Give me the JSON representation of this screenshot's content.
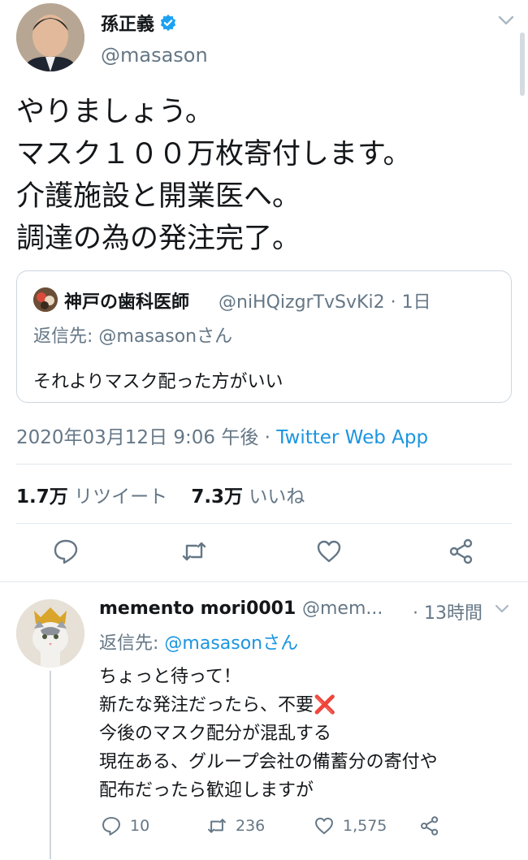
{
  "main_tweet": {
    "display_name": "孫正義",
    "handle": "@masason",
    "text_lines": [
      "やりましょう。",
      "マスク１００万枚寄付します。",
      "介護施設と開業医へ。",
      "調達の為の発注完了。"
    ],
    "quoted": {
      "display_name": "神戸の歯科医師",
      "handle": "@niHQizgrTvSvKi2",
      "age": "1日",
      "reply_prefix": "返信先: ",
      "reply_to": "@masasonさん",
      "text": "それよりマスク配った方がいい"
    },
    "timestamp": "2020年03月12日 9:06 午後",
    "separator": " · ",
    "source": "Twitter Web App",
    "retweets_count": "1.7万",
    "retweets_label": "リツイート",
    "likes_count": "7.3万",
    "likes_label": "いいね"
  },
  "reply_tweet": {
    "display_name": "memento mori0001",
    "handle": "@mem...",
    "age": "· 13時間",
    "reply_prefix": "返信先: ",
    "reply_to": "@masasonさん",
    "line1": "ちょっと待って！",
    "line2": "新たな発注だったら、不要",
    "line2_emoji": "❌",
    "line3": "今後のマスク配分が混乱する",
    "line4": "現在ある、グループ会社の備蓄分の寄付や",
    "line5": "配布だったら歓迎しますが",
    "reply_count": "10",
    "retweet_count": "236",
    "like_count": "1,575"
  },
  "colors": {
    "link": "#1b95e0",
    "secondary_text": "#657786",
    "divider": "#e1e8ed",
    "verified": "#1da1f2"
  },
  "icons": [
    "verified-badge-icon",
    "chevron-down-icon",
    "reply-icon",
    "retweet-icon",
    "like-icon",
    "share-icon"
  ]
}
